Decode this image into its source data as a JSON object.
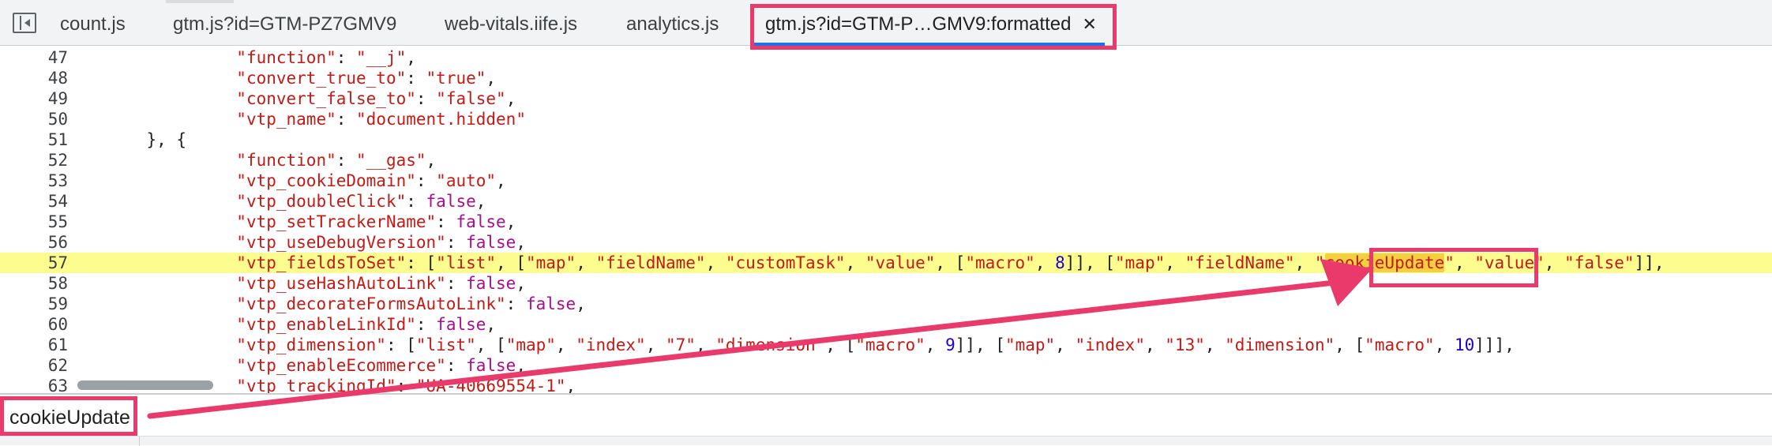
{
  "tabs": [
    {
      "label": "count.js"
    },
    {
      "label": "gtm.js?id=GTM-PZ7GMV9"
    },
    {
      "label": "web-vitals.iife.js"
    },
    {
      "label": "analytics.js"
    },
    {
      "label": "gtm.js?id=GTM-P…GMV9:formatted",
      "close": "✕",
      "active": true
    }
  ],
  "icons": {
    "sidebar_toggle": "sidebar-panel-toggle-icon",
    "close": "close-icon"
  },
  "colors": {
    "annotation": "#ea3a6c",
    "current_line": "#fdfc8f",
    "match": "#f4d03f",
    "string": "#c41a16",
    "keyword": "#a90d91",
    "number": "#1c00cf"
  },
  "editor": {
    "lines": [
      {
        "n": "47",
        "tokens": [
          [
            "      ",
            "p"
          ],
          [
            "\"function\"",
            "s"
          ],
          [
            ": ",
            "p"
          ],
          [
            "\"__j\"",
            "s"
          ],
          [
            ",",
            "p"
          ]
        ]
      },
      {
        "n": "48",
        "tokens": [
          [
            "      ",
            "p"
          ],
          [
            "\"convert_true_to\"",
            "s"
          ],
          [
            ": ",
            "p"
          ],
          [
            "\"true\"",
            "s"
          ],
          [
            ",",
            "p"
          ]
        ]
      },
      {
        "n": "49",
        "tokens": [
          [
            "      ",
            "p"
          ],
          [
            "\"convert_false_to\"",
            "s"
          ],
          [
            ": ",
            "p"
          ],
          [
            "\"false\"",
            "s"
          ],
          [
            ",",
            "p"
          ]
        ]
      },
      {
        "n": "50",
        "tokens": [
          [
            "      ",
            "p"
          ],
          [
            "\"vtp_name\"",
            "s"
          ],
          [
            ": ",
            "p"
          ],
          [
            "\"document.hidden\"",
            "s"
          ]
        ]
      },
      {
        "n": "51",
        "tokens": [
          [
            "  }, {",
            "p"
          ]
        ]
      },
      {
        "n": "52",
        "tokens": [
          [
            "      ",
            "p"
          ],
          [
            "\"function\"",
            "s"
          ],
          [
            ": ",
            "p"
          ],
          [
            "\"__gas\"",
            "s"
          ],
          [
            ",",
            "p"
          ]
        ]
      },
      {
        "n": "53",
        "tokens": [
          [
            "      ",
            "p"
          ],
          [
            "\"vtp_cookieDomain\"",
            "s"
          ],
          [
            ": ",
            "p"
          ],
          [
            "\"auto\"",
            "s"
          ],
          [
            ",",
            "p"
          ]
        ]
      },
      {
        "n": "54",
        "tokens": [
          [
            "      ",
            "p"
          ],
          [
            "\"vtp_doubleClick\"",
            "s"
          ],
          [
            ": ",
            "p"
          ],
          [
            "false",
            "k"
          ],
          [
            ",",
            "p"
          ]
        ]
      },
      {
        "n": "55",
        "tokens": [
          [
            "      ",
            "p"
          ],
          [
            "\"vtp_setTrackerName\"",
            "s"
          ],
          [
            ": ",
            "p"
          ],
          [
            "false",
            "k"
          ],
          [
            ",",
            "p"
          ]
        ]
      },
      {
        "n": "56",
        "tokens": [
          [
            "      ",
            "p"
          ],
          [
            "\"vtp_useDebugVersion\"",
            "s"
          ],
          [
            ": ",
            "p"
          ],
          [
            "false",
            "k"
          ],
          [
            ",",
            "p"
          ]
        ]
      },
      {
        "n": "57",
        "current": true,
        "tokens": [
          [
            "      ",
            "p"
          ],
          [
            "\"vtp_fieldsToSet\"",
            "s"
          ],
          [
            ": [",
            "p"
          ],
          [
            "\"list\"",
            "s"
          ],
          [
            ", [",
            "p"
          ],
          [
            "\"map\"",
            "s"
          ],
          [
            ", ",
            "p"
          ],
          [
            "\"fieldName\"",
            "s"
          ],
          [
            ", ",
            "p"
          ],
          [
            "\"customTask\"",
            "s"
          ],
          [
            ", ",
            "p"
          ],
          [
            "\"value\"",
            "s"
          ],
          [
            ", [",
            "p"
          ],
          [
            "\"macro\"",
            "s"
          ],
          [
            ", ",
            "p"
          ],
          [
            "8",
            "n"
          ],
          [
            "]], [",
            "p"
          ],
          [
            "\"map\"",
            "s"
          ],
          [
            ", ",
            "p"
          ],
          [
            "\"fieldName\"",
            "s"
          ],
          [
            ", ",
            "p"
          ],
          [
            "\"",
            "s"
          ],
          [
            "cookieUpdate",
            "s match"
          ],
          [
            "\"",
            "s"
          ],
          [
            ", ",
            "p"
          ],
          [
            "\"value\"",
            "s"
          ],
          [
            ", ",
            "p"
          ],
          [
            "\"false\"",
            "s"
          ],
          [
            "]],",
            "p"
          ]
        ]
      },
      {
        "n": "58",
        "tokens": [
          [
            "      ",
            "p"
          ],
          [
            "\"vtp_useHashAutoLink\"",
            "s"
          ],
          [
            ": ",
            "p"
          ],
          [
            "false",
            "k"
          ],
          [
            ",",
            "p"
          ]
        ]
      },
      {
        "n": "59",
        "tokens": [
          [
            "      ",
            "p"
          ],
          [
            "\"vtp_decorateFormsAutoLink\"",
            "s"
          ],
          [
            ": ",
            "p"
          ],
          [
            "false",
            "k"
          ],
          [
            ",",
            "p"
          ]
        ]
      },
      {
        "n": "60",
        "tokens": [
          [
            "      ",
            "p"
          ],
          [
            "\"vtp_enableLinkId\"",
            "s"
          ],
          [
            ": ",
            "p"
          ],
          [
            "false",
            "k"
          ],
          [
            ",",
            "p"
          ]
        ]
      },
      {
        "n": "61",
        "tokens": [
          [
            "      ",
            "p"
          ],
          [
            "\"vtp_dimension\"",
            "s"
          ],
          [
            ": [",
            "p"
          ],
          [
            "\"list\"",
            "s"
          ],
          [
            ", [",
            "p"
          ],
          [
            "\"map\"",
            "s"
          ],
          [
            ", ",
            "p"
          ],
          [
            "\"index\"",
            "s"
          ],
          [
            ", ",
            "p"
          ],
          [
            "\"7\"",
            "s"
          ],
          [
            ", ",
            "p"
          ],
          [
            "\"dimension\"",
            "s"
          ],
          [
            ", [",
            "p"
          ],
          [
            "\"macro\"",
            "s"
          ],
          [
            ", ",
            "p"
          ],
          [
            "9",
            "n"
          ],
          [
            "]], [",
            "p"
          ],
          [
            "\"map\"",
            "s"
          ],
          [
            ", ",
            "p"
          ],
          [
            "\"index\"",
            "s"
          ],
          [
            ", ",
            "p"
          ],
          [
            "\"13\"",
            "s"
          ],
          [
            ", ",
            "p"
          ],
          [
            "\"dimension\"",
            "s"
          ],
          [
            ", [",
            "p"
          ],
          [
            "\"macro\"",
            "s"
          ],
          [
            ", ",
            "p"
          ],
          [
            "10",
            "n"
          ],
          [
            "]]],",
            "p"
          ]
        ]
      },
      {
        "n": "62",
        "tokens": [
          [
            "      ",
            "p"
          ],
          [
            "\"vtp_enableEcommerce\"",
            "s"
          ],
          [
            ": ",
            "p"
          ],
          [
            "false",
            "k"
          ],
          [
            ",",
            "p"
          ]
        ]
      },
      {
        "n": "63",
        "tokens": [
          [
            "      ",
            "p"
          ],
          [
            "\"vtp_trackingId\"",
            "s"
          ],
          [
            ": ",
            "p"
          ],
          [
            "\"UA-40669554-1\"",
            "s"
          ],
          [
            ",",
            "p"
          ]
        ]
      }
    ]
  },
  "search": {
    "value": "cookieUpdate"
  }
}
